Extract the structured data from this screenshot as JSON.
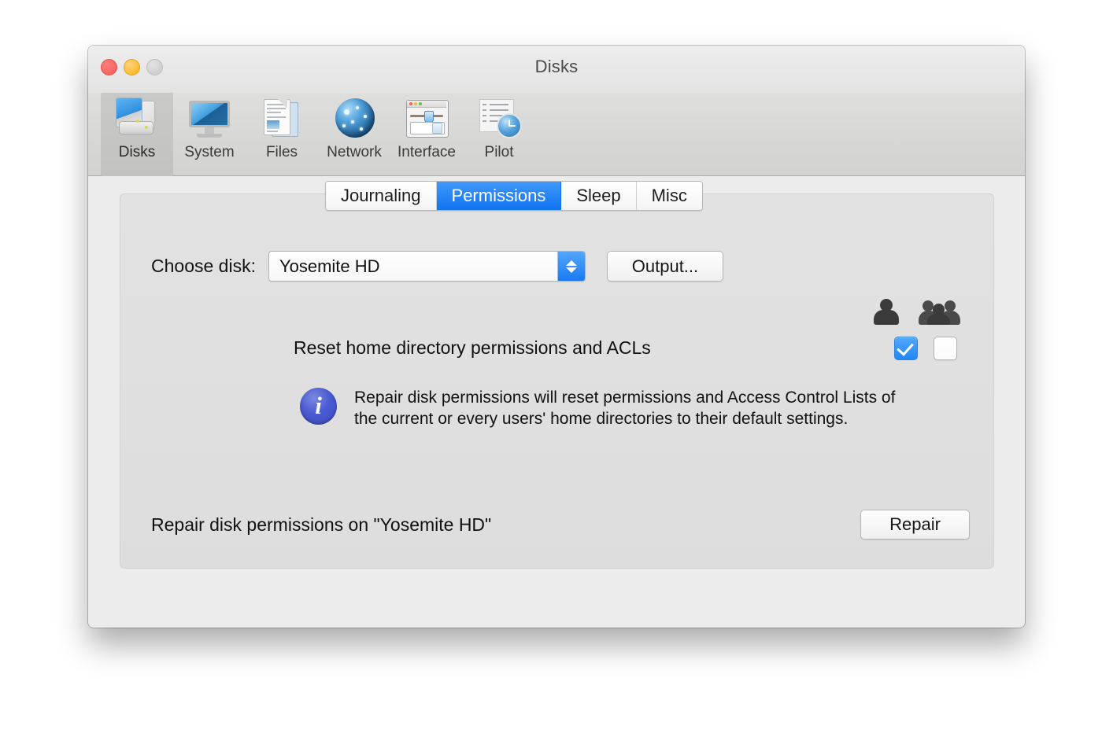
{
  "window": {
    "title": "Disks",
    "traffic_lights": [
      {
        "name": "close",
        "color": "#f5655f"
      },
      {
        "name": "minimize",
        "color": "#fcbb30"
      },
      {
        "name": "zoom",
        "color": "#cfcfcf"
      }
    ]
  },
  "toolbar": {
    "items": [
      {
        "label": "Disks",
        "icon": "disk-icon",
        "selected": true
      },
      {
        "label": "System",
        "icon": "monitor-icon",
        "selected": false
      },
      {
        "label": "Files",
        "icon": "documents-icon",
        "selected": false
      },
      {
        "label": "Network",
        "icon": "globe-icon",
        "selected": false
      },
      {
        "label": "Interface",
        "icon": "window-controls-icon",
        "selected": false
      },
      {
        "label": "Pilot",
        "icon": "clock-list-icon",
        "selected": false
      }
    ]
  },
  "tabs": {
    "items": [
      {
        "label": "Journaling",
        "active": false
      },
      {
        "label": "Permissions",
        "active": true
      },
      {
        "label": "Sleep",
        "active": false
      },
      {
        "label": "Misc",
        "active": false
      }
    ],
    "accent_color": "#1173ef"
  },
  "disk_row": {
    "label": "Choose disk:",
    "selected_disk": "Yosemite HD",
    "output_button": "Output..."
  },
  "permissions": {
    "reset_label": "Reset home directory permissions and ACLs",
    "user_checkbox_checked": true,
    "group_checkbox_checked": false,
    "user_icon": "single-user-icon",
    "group_icon": "group-users-icon"
  },
  "info": {
    "icon": "info-icon",
    "text": "Repair disk permissions will reset permissions and Access Control Lists of the current or every users' home directories to their default settings.",
    "icon_color": "#4a5ad2"
  },
  "repair": {
    "label": "Repair disk permissions on \"Yosemite HD\"",
    "button": "Repair"
  }
}
